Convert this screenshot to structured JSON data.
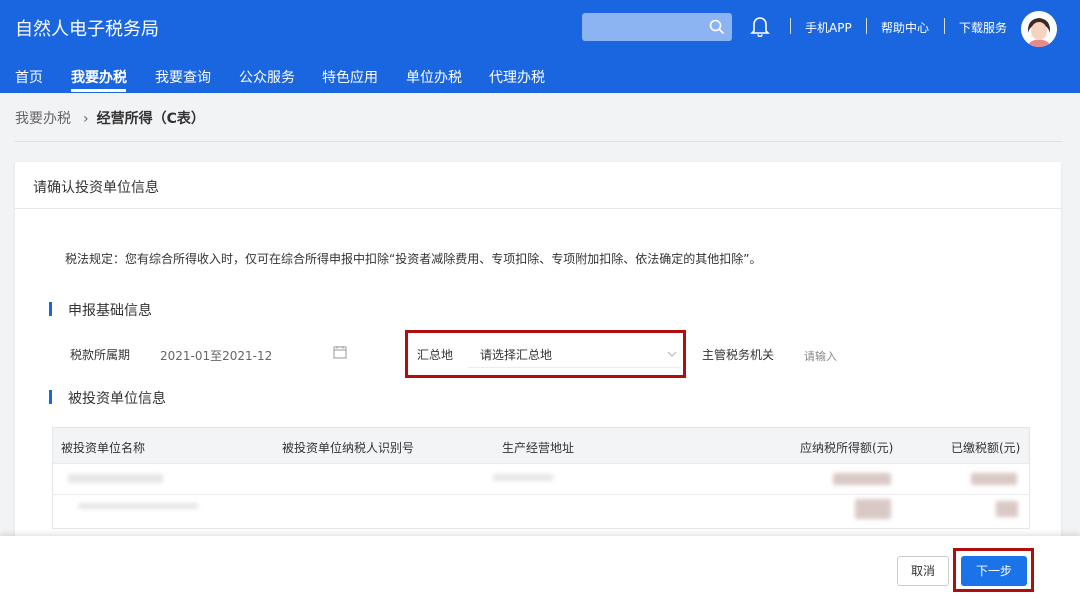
{
  "header": {
    "app_title": "自然人电子税务局",
    "links": [
      "手机APP",
      "帮助中心",
      "下载服务"
    ],
    "colors": {
      "brand": "#1a66e0",
      "highlight": "#b00d0d"
    }
  },
  "nav": {
    "items": [
      "首页",
      "我要办税",
      "我要查询",
      "公众服务",
      "特色应用",
      "单位办税",
      "代理办税"
    ],
    "active": "我要办税"
  },
  "breadcrumb": {
    "home": "我要办税",
    "current": "经营所得（C表）"
  },
  "card": {
    "title": "请确认投资单位信息",
    "notice": "税法规定：您有综合所得收入时，仅可在综合所得申报中扣除“投资者减除费用、专项扣除、专项附加扣除、依法确定的其他扣除”。"
  },
  "basic_info": {
    "section_title": "申报基础信息",
    "period_label": "税款所属期",
    "period_value": "2021-01至2021-12",
    "summary_label": "汇总地",
    "summary_placeholder": "请选择汇总地",
    "tax_authority_label": "主管税务机关",
    "tax_authority_placeholder": "请输入"
  },
  "invested_units": {
    "section_title": "被投资单位信息",
    "columns": [
      "被投资单位名称",
      "被投资单位纳税人识别号",
      "生产经营地址",
      "应纳税所得额(元)",
      "已缴税额(元)"
    ]
  },
  "footer": {
    "cancel_label": "取消",
    "next_label": "下一步"
  }
}
